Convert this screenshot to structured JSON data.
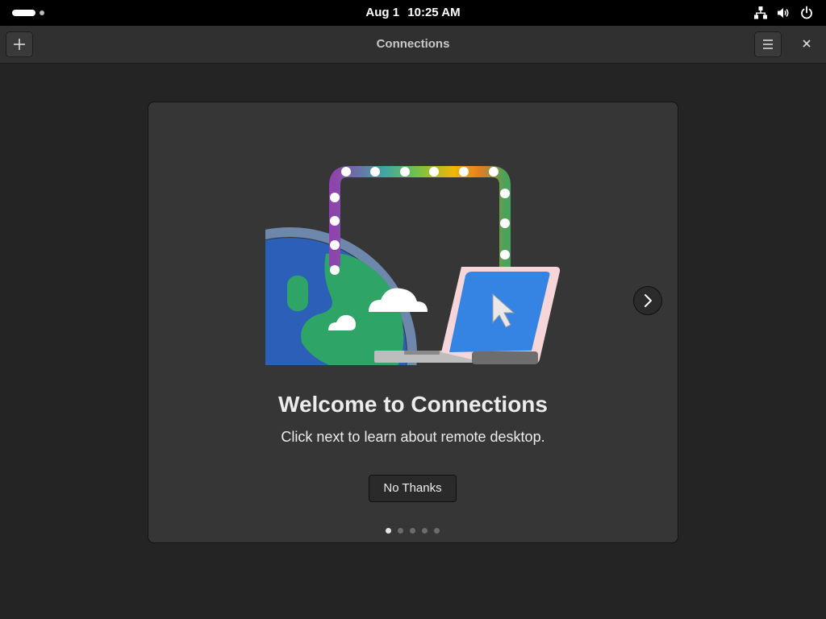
{
  "topbar": {
    "date": "Aug 1",
    "time": "10:25 AM",
    "icons": [
      "activities-indicator",
      "network-icon",
      "volume-icon",
      "power-icon"
    ]
  },
  "headerbar": {
    "title": "Connections",
    "icons": [
      "add-icon",
      "hamburger-menu-icon",
      "close-icon"
    ]
  },
  "onboarding": {
    "title": "Welcome to Connections",
    "subtitle": "Click next to learn about remote desktop.",
    "dismiss_label": "No Thanks",
    "next_icon": "chevron-right-icon",
    "current_page": 1,
    "total_pages": 5
  },
  "colors": {
    "background": "#242424",
    "card": "#363636",
    "topbar": "#000000",
    "headerbar": "#303030"
  }
}
